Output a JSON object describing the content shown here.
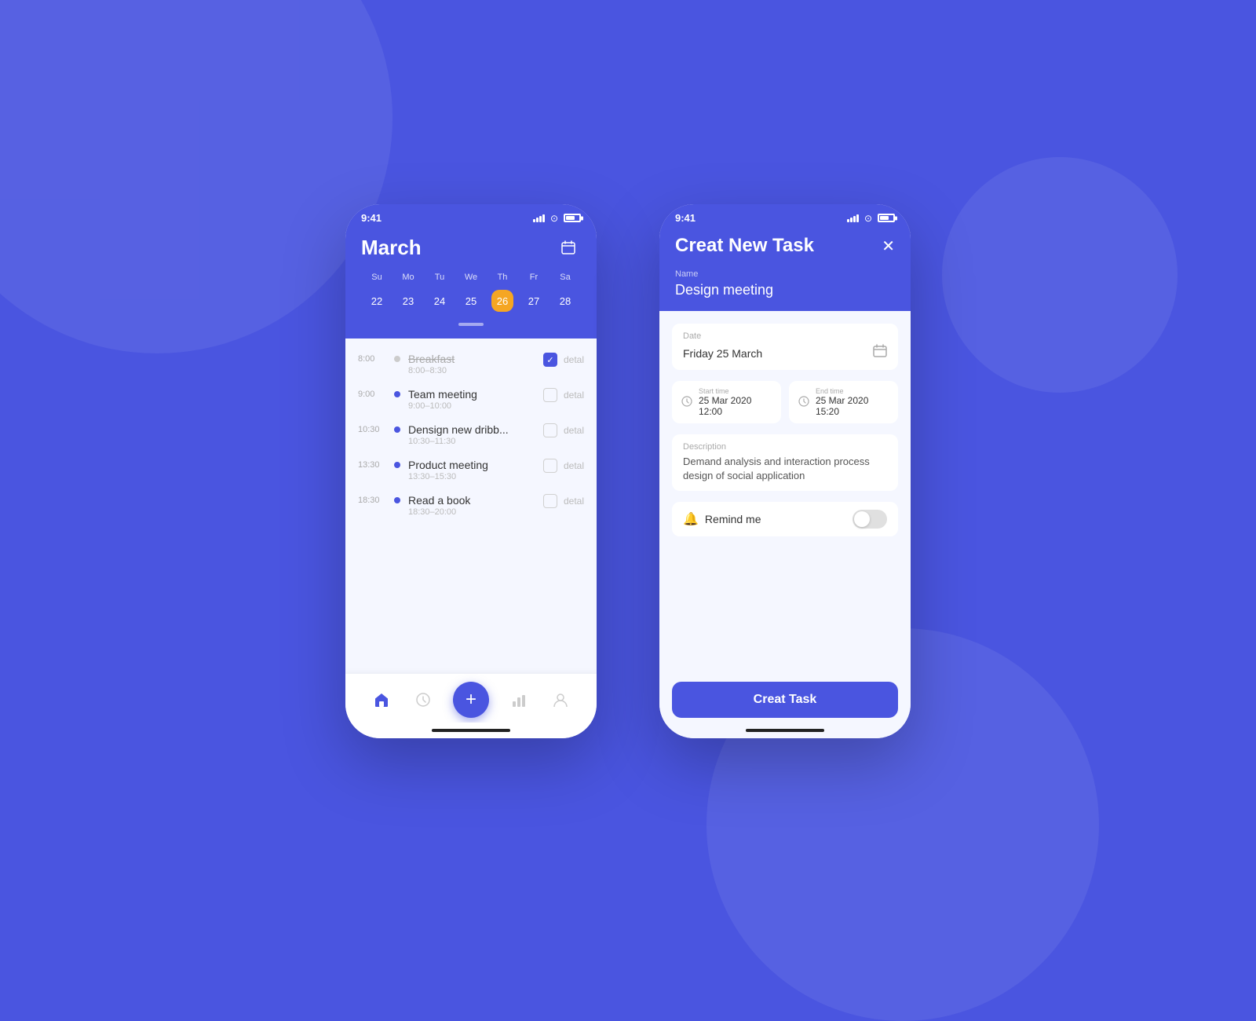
{
  "background": {
    "color": "#4a55e0"
  },
  "phone1": {
    "status_bar": {
      "time": "9:41"
    },
    "header": {
      "month": "March",
      "weekdays": [
        "Su",
        "Mo",
        "Tu",
        "We",
        "Th",
        "Fr",
        "Sa"
      ],
      "dates": [
        "22",
        "23",
        "24",
        "25",
        "26",
        "27",
        "28"
      ],
      "active_date": "26"
    },
    "schedule": [
      {
        "time": "8:00",
        "name": "Breakfast",
        "range": "8:00–8:30",
        "done": true,
        "strikethrough": true,
        "dot_color": "grey"
      },
      {
        "time": "9:00",
        "name": "Team meeting",
        "range": "9:00–10:00",
        "done": false,
        "strikethrough": false,
        "dot_color": "blue"
      },
      {
        "time": "10:30",
        "name": "Densign new dribb...",
        "range": "10:30–11:30",
        "done": false,
        "strikethrough": false,
        "dot_color": "blue"
      },
      {
        "time": "13:30",
        "name": "Product meeting",
        "range": "13:30–15:30",
        "done": false,
        "strikethrough": false,
        "dot_color": "blue"
      },
      {
        "time": "18:30",
        "name": "Read a book",
        "range": "18:30–20:00",
        "done": false,
        "strikethrough": false,
        "dot_color": "blue"
      }
    ],
    "nav": {
      "items": [
        "home",
        "clock",
        "plus",
        "chart",
        "user"
      ],
      "detail_label": "detal"
    }
  },
  "phone2": {
    "status_bar": {
      "time": "9:41"
    },
    "header": {
      "title": "Creat New Task",
      "name_label": "Name",
      "name_value": "Design meeting"
    },
    "date_section": {
      "label": "Date",
      "value": "Friday 25 March"
    },
    "start_time": {
      "label": "Start time",
      "value": "25 Mar 2020  12:00"
    },
    "end_time": {
      "label": "End time",
      "value": "25 Mar 2020  15:20"
    },
    "description": {
      "label": "Description",
      "value": "Demand analysis and interaction process design of social application"
    },
    "remind": {
      "label": "Remind me",
      "enabled": false
    },
    "create_button": {
      "label": "Creat Task"
    }
  }
}
